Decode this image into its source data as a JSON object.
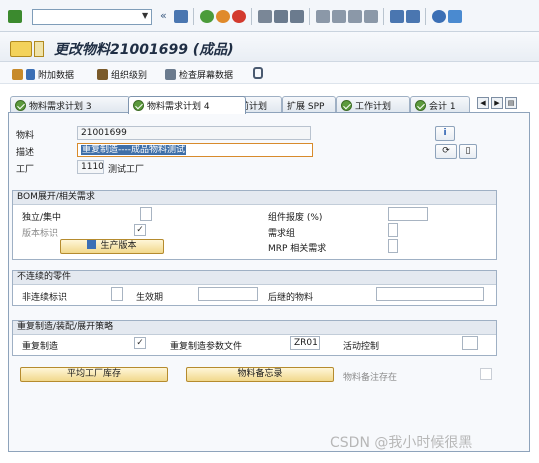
{
  "title": "更改物料21001699 (成品)",
  "toolbar": {
    "command_field": ""
  },
  "app_toolbar": [
    {
      "label": "附加数据"
    },
    {
      "label": "组织级别"
    },
    {
      "label": "检查屏幕数据"
    }
  ],
  "tabs": [
    {
      "label": "物料需求计划 3",
      "active": false
    },
    {
      "label": "物料需求计划 4",
      "active": true
    },
    {
      "label": "提前计划",
      "active": false
    },
    {
      "label": "扩展 SPP",
      "active": false
    },
    {
      "label": "工作计划",
      "active": false
    },
    {
      "label": "会计 1",
      "active": false
    }
  ],
  "header": {
    "material_label": "物料",
    "material_value": "21001699",
    "desc_label": "描述",
    "desc_value": "重复制造----成品物料测试",
    "plant_label": "工厂",
    "plant_value": "1110",
    "plant_name": "测试工厂"
  },
  "bom": {
    "title": "BOM展开/相关需求",
    "indiv_coll_label": "独立/集中",
    "indiv_coll_value": "",
    "version_ind_label": "版本标识",
    "version_ind_checked": "✓",
    "prod_version_btn": "生产版本",
    "component_scrap_label": "组件报废 (%)",
    "component_scrap_value": "",
    "req_group_label": "需求组",
    "mrp_dep_label": "MRP 相关需求"
  },
  "discontinued": {
    "title": "不连续的零件",
    "ind_label": "非连续标识",
    "eff_out_label": "生效期",
    "follow_up_label": "后继的物料"
  },
  "rem": {
    "title": "重复制造/装配/展开策略",
    "rep_mfg_label": "重复制造",
    "rep_mfg_checked": "✓",
    "profile_label": "重复制造参数文件",
    "profile_value": "ZR01",
    "action_ctrl_label": "活动控制"
  },
  "bottom": {
    "plant_stock_btn": "平均工厂库存",
    "memo_btn": "物料备忘录",
    "memo_exists_label": "物料备注存在"
  },
  "watermark": "CSDN @我小时候很黑"
}
